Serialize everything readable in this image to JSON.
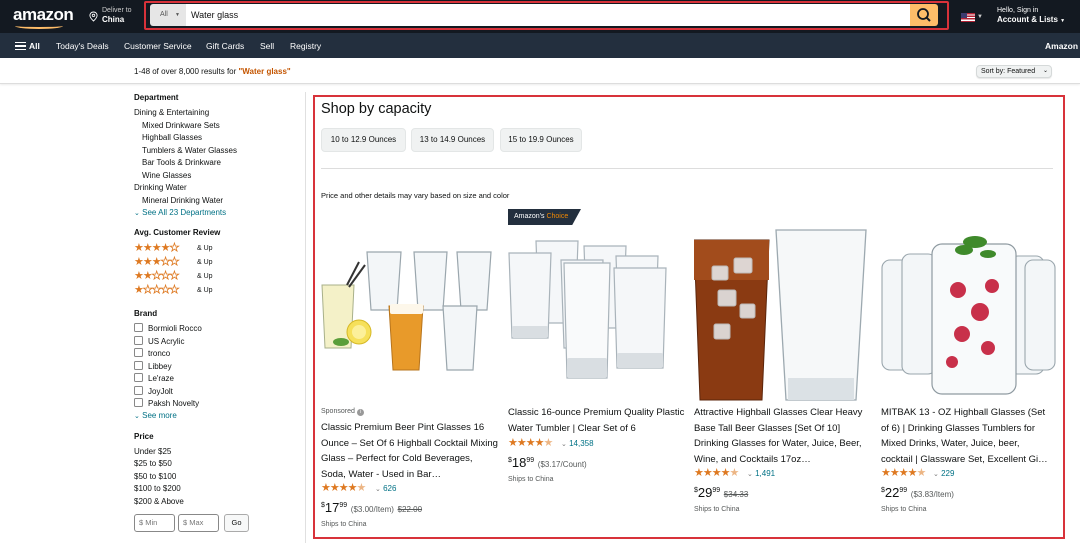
{
  "header": {
    "logo": "amazon",
    "deliver_line1": "Deliver to",
    "deliver_line2": "China",
    "search_category": "All",
    "search_value": "Water glass",
    "account_line1": "Hello, Sign in",
    "account_line2": "Account & Lists"
  },
  "subnav": {
    "all": "All",
    "items": [
      "Today's Deals",
      "Customer Service",
      "Gift Cards",
      "Sell",
      "Registry"
    ],
    "right": "Amazon"
  },
  "results": {
    "prefix": "1-48 of over 8,000 results for ",
    "query": "\"Water glass\"",
    "sort_label": "Sort by:  Featured"
  },
  "sidebar": {
    "department_heading": "Department",
    "departments": [
      "Dining & Entertaining",
      "Mixed Drinkware Sets",
      "Highball Glasses",
      "Tumblers & Water Glasses",
      "Bar Tools & Drinkware",
      "Wine Glasses",
      "Drinking Water",
      "Mineral Drinking Water"
    ],
    "see_all_departments": "See All 23 Departments",
    "review_heading": "Avg. Customer Review",
    "review_levels": [
      4,
      3,
      2,
      1
    ],
    "and_up": "& Up",
    "brand_heading": "Brand",
    "brands": [
      "Bormioli Rocco",
      "US Acrylic",
      "tronco",
      "Libbey",
      "Le'raze",
      "JoyJolt",
      "Paksh Novelty"
    ],
    "see_more": "See more",
    "price_heading": "Price",
    "prices": [
      "Under $25",
      "$25 to $50",
      "$50 to $100",
      "$100 to $200",
      "$200 & Above"
    ],
    "min_placeholder": "$ Min",
    "max_placeholder": "$ Max",
    "go": "Go"
  },
  "main": {
    "title": "Shop by capacity",
    "chips": [
      "10 to 12.9 Ounces",
      "13 to 14.9 Ounces",
      "15 to 19.9 Ounces"
    ],
    "disclaimer": "Price and other details may vary based on size and color",
    "badge_prefix": "Amazon's",
    "badge_suffix": "Choice",
    "sponsored": "Sponsored",
    "products": [
      {
        "title": "Classic Premium Beer Pint Glasses 16 Ounce – Set Of 6 Highball Cocktail Mixing Glass – Perfect for Cold Beverages, Soda, Water - Used in Bar…",
        "rating": 4.5,
        "reviews": "626",
        "price_whole": "17",
        "price_frac": "99",
        "per_unit": "($3.00/Item)",
        "was": "$22.00",
        "ships": "Ships to China"
      },
      {
        "title": "Classic 16-ounce Premium Quality Plastic Water Tumbler | Clear Set of 6",
        "rating": 4.5,
        "reviews": "14,358",
        "price_whole": "18",
        "price_frac": "99",
        "per_unit": "($3.17/Count)",
        "was": "",
        "ships": "Ships to China"
      },
      {
        "title": "Attractive Highball Glasses Clear Heavy Base Tall Beer Glasses [Set Of 10] Drinking Glasses for Water, Juice, Beer, Wine, and Cocktails 17oz…",
        "rating": 4.5,
        "reviews": "1,491",
        "price_whole": "29",
        "price_frac": "99",
        "per_unit": "",
        "was": "$34.33",
        "ships": "Ships to China"
      },
      {
        "title": "MITBAK 13 - OZ Highball Glasses (Set of 6) | Drinking Glasses Tumblers for Mixed Drinks, Water, Juice, beer, cocktail | Glassware Set, Excellent Gi…",
        "rating": 4.5,
        "reviews": "229",
        "price_whole": "22",
        "price_frac": "99",
        "per_unit": "($3.83/Item)",
        "was": "",
        "ships": "Ships to China"
      }
    ]
  },
  "colors": {
    "nav_dark": "#131921",
    "subnav": "#232f3e",
    "search_button": "#febd69",
    "highlight_border": "#d8323a",
    "star": "#de7921",
    "link": "#007185",
    "query": "#c45500"
  }
}
